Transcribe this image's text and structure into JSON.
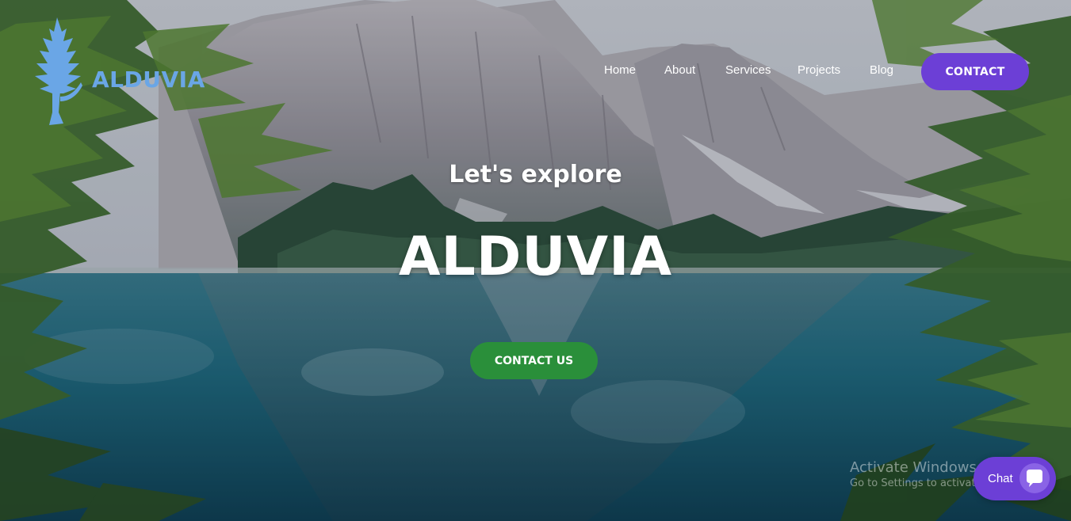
{
  "brand": {
    "logo_text": "ALDUVIA",
    "logo_color": "#6aa6e6"
  },
  "nav": {
    "items": [
      {
        "label": "Home"
      },
      {
        "label": "About"
      },
      {
        "label": "Services"
      },
      {
        "label": "Projects"
      },
      {
        "label": "Blog"
      }
    ],
    "contact_label": "CONTACT"
  },
  "hero": {
    "tagline": "Let's explore",
    "title": "ALDUVIA",
    "cta_label": "CONTACT US"
  },
  "watermark": {
    "line1": "Activate Windows",
    "line2": "Go to Settings to activate Windows."
  },
  "chat": {
    "label": "Chat"
  },
  "colors": {
    "accent_purple": "#6c3fd6",
    "cta_green": "#2a8f3a"
  }
}
